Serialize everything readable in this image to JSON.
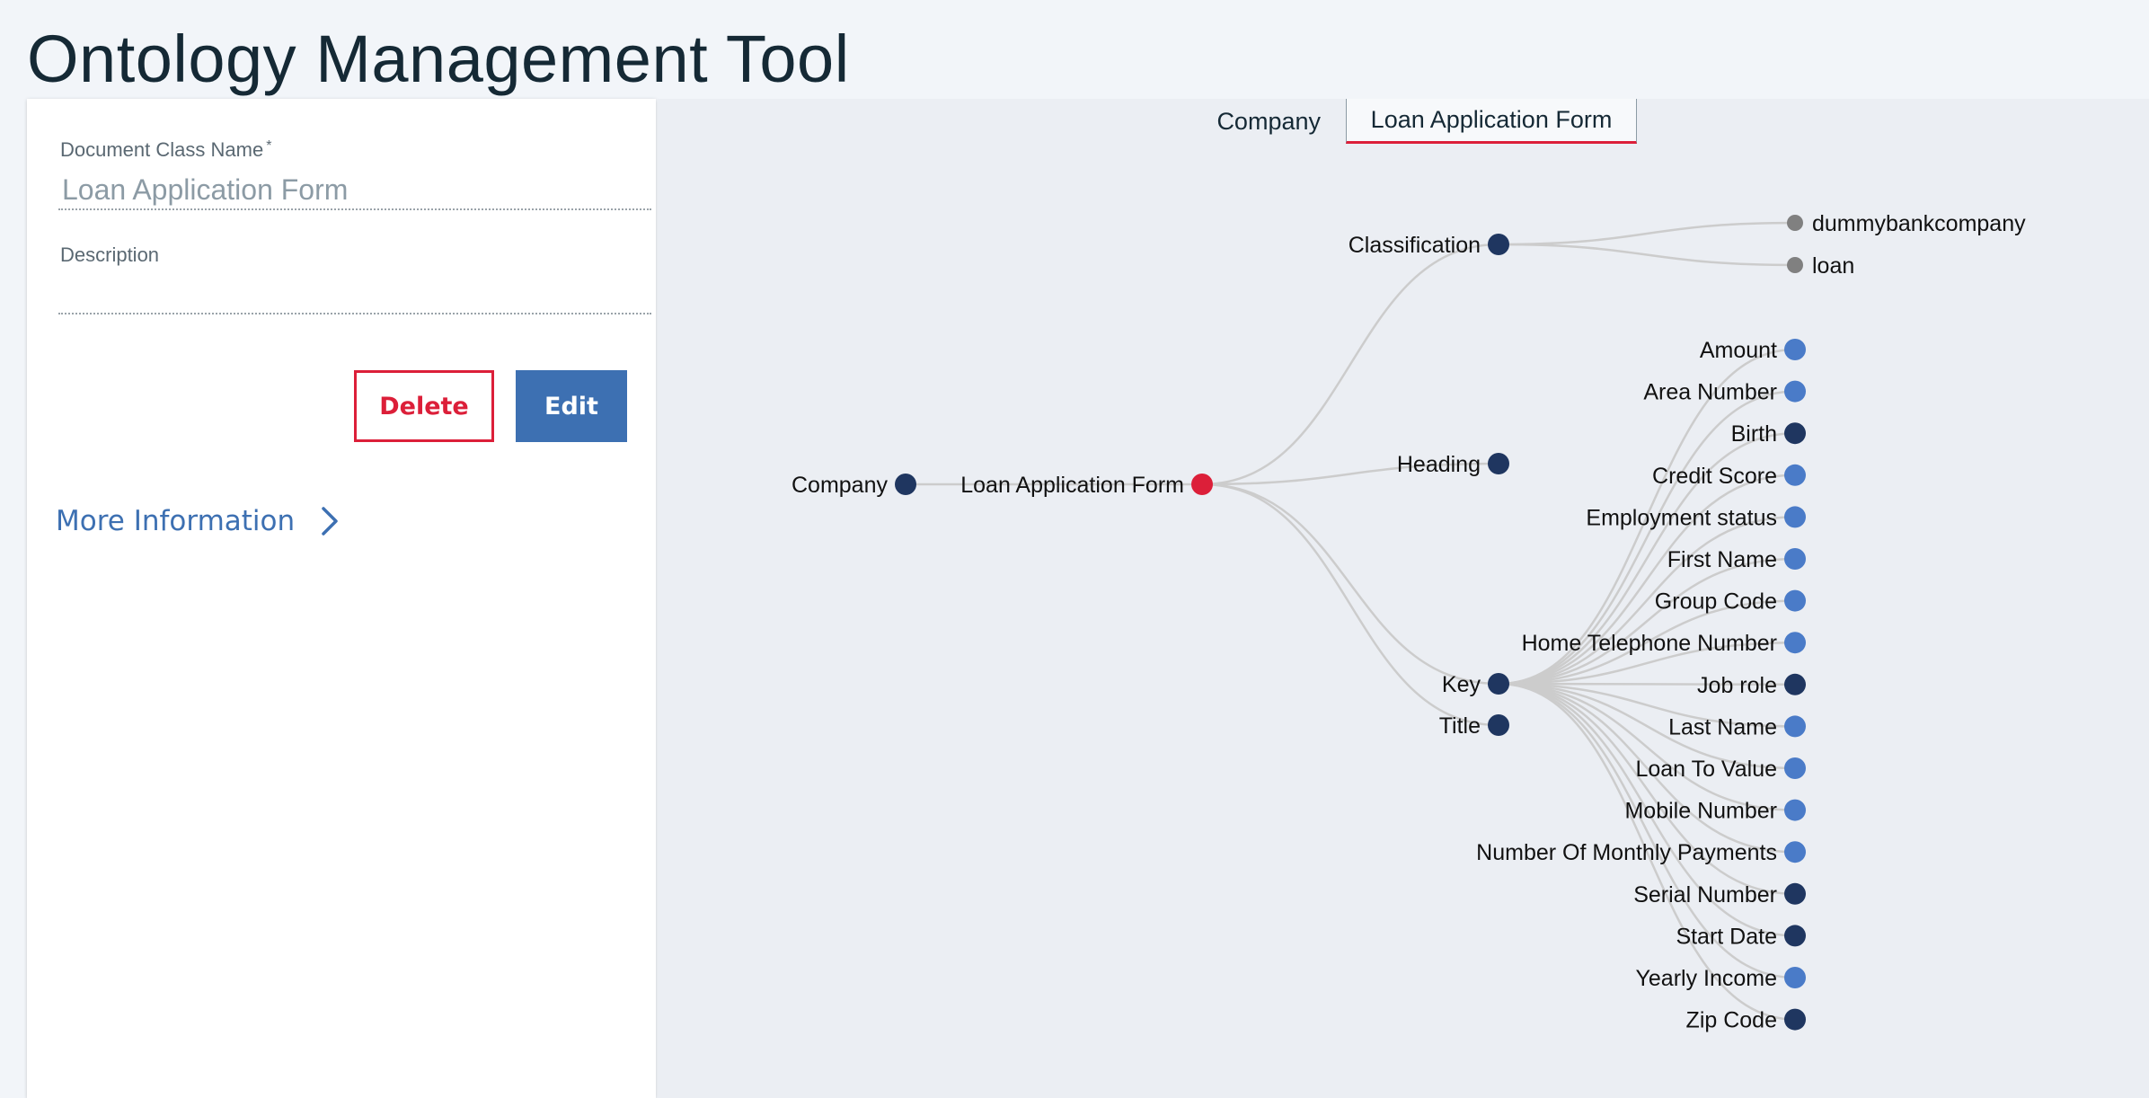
{
  "app": {
    "title": "Ontology Management Tool"
  },
  "form": {
    "class_name_label": "Document Class Name",
    "required_mark": "*",
    "class_name_placeholder": "Loan Application Form",
    "description_label": "Description",
    "description_value": "",
    "delete_label": "Delete",
    "edit_label": "Edit",
    "more_info_label": "More Information"
  },
  "breadcrumb": {
    "tabs": [
      {
        "label": "Company",
        "active": false
      },
      {
        "label": "Loan Application Form",
        "active": true
      }
    ]
  },
  "colors": {
    "accent_red": "#dc1f39",
    "primary_blue": "#3d70b2",
    "node_dark": "#1f3660",
    "node_light": "#4a7bc8",
    "node_gray": "#808080",
    "link": "#cccccc"
  },
  "tree": {
    "root": {
      "label": "Loan Application Form",
      "color": "#dc1f39",
      "parent": {
        "label": "Company",
        "color": "#1f3660"
      },
      "children": [
        {
          "label": "Classification",
          "color": "#1f3660",
          "children": [
            {
              "label": "dummybankcompany",
              "color": "#808080"
            },
            {
              "label": "loan",
              "color": "#808080"
            }
          ]
        },
        {
          "label": "Heading",
          "color": "#1f3660",
          "children": []
        },
        {
          "label": "Key",
          "color": "#1f3660",
          "children": [
            {
              "label": "Amount",
              "color": "#4a7bc8"
            },
            {
              "label": "Area Number",
              "color": "#4a7bc8"
            },
            {
              "label": "Birth",
              "color": "#1f3660"
            },
            {
              "label": "Credit Score",
              "color": "#4a7bc8"
            },
            {
              "label": "Employment status",
              "color": "#4a7bc8"
            },
            {
              "label": "First Name",
              "color": "#4a7bc8"
            },
            {
              "label": "Group Code",
              "color": "#4a7bc8"
            },
            {
              "label": "Home Telephone Number",
              "color": "#4a7bc8"
            },
            {
              "label": "Job role",
              "color": "#1f3660"
            },
            {
              "label": "Last Name",
              "color": "#4a7bc8"
            },
            {
              "label": "Loan To Value",
              "color": "#4a7bc8"
            },
            {
              "label": "Mobile Number",
              "color": "#4a7bc8"
            },
            {
              "label": "Number Of Monthly Payments",
              "color": "#4a7bc8"
            },
            {
              "label": "Serial Number",
              "color": "#1f3660"
            },
            {
              "label": "Start Date",
              "color": "#1f3660"
            },
            {
              "label": "Yearly Income",
              "color": "#4a7bc8"
            },
            {
              "label": "Zip Code",
              "color": "#1f3660"
            }
          ]
        },
        {
          "label": "Title",
          "color": "#1f3660",
          "children": []
        }
      ]
    }
  }
}
